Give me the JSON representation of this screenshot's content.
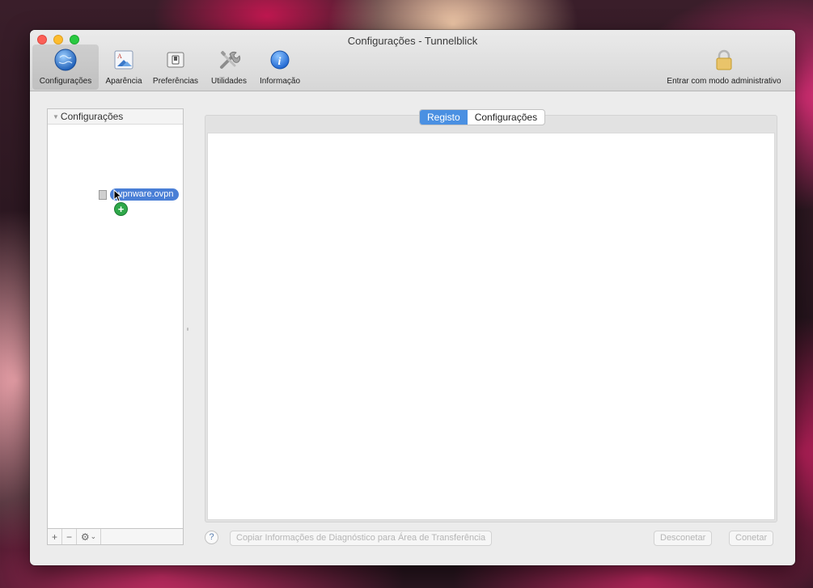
{
  "window": {
    "title": "Configurações - Tunnelblick"
  },
  "toolbar": {
    "items": [
      {
        "label": "Configurações",
        "icon": "globe-icon",
        "selected": true
      },
      {
        "label": "Aparência",
        "icon": "appearance-icon",
        "selected": false
      },
      {
        "label": "Preferências",
        "icon": "switch-icon",
        "selected": false
      },
      {
        "label": "Utilidades",
        "icon": "tools-icon",
        "selected": false
      },
      {
        "label": "Informação",
        "icon": "info-icon",
        "selected": false
      }
    ],
    "admin": {
      "label": "Entrar com modo administrativo",
      "icon": "lock-icon"
    }
  },
  "sidebar": {
    "header": "Configurações",
    "drag_item": {
      "label": "vpnware.ovpn",
      "badge": "+"
    },
    "footer": {
      "add": "+",
      "remove": "−",
      "gear": "⚙",
      "chevron": "⌄"
    }
  },
  "tabs": [
    {
      "label": "Registo",
      "active": true
    },
    {
      "label": "Configurações",
      "active": false
    }
  ],
  "bottom": {
    "help": "?",
    "copy_diagnostics": "Copiar Informações de Diagnóstico para Área de Transferência",
    "disconnect": "Desconetar",
    "connect": "Conetar"
  },
  "colors": {
    "accent": "#4a90e2",
    "drag_pill": "#4a7fd6",
    "add_badge": "#2fa84a"
  }
}
